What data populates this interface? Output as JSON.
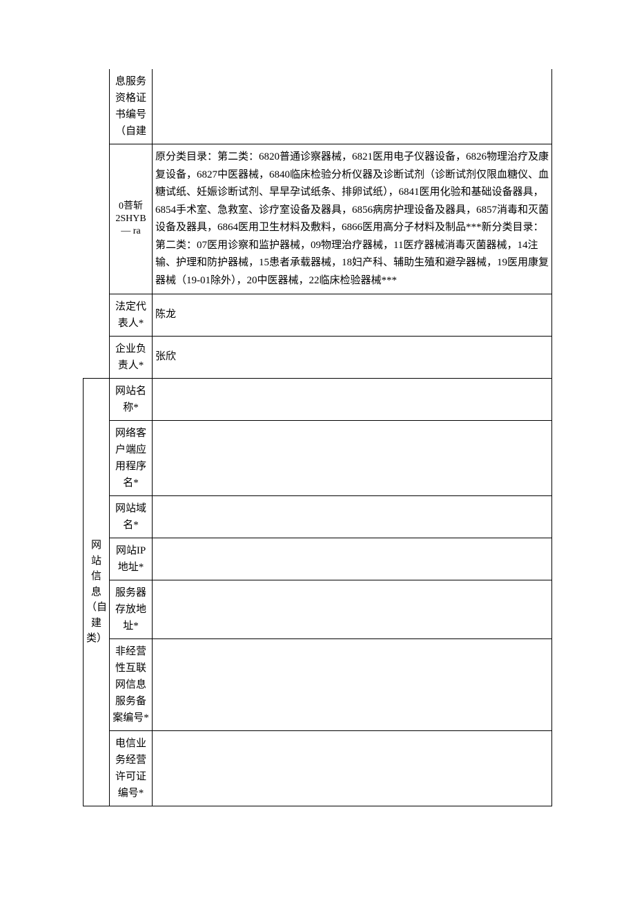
{
  "group1": {
    "label_fragment": "",
    "rows": [
      {
        "label": "息服务资格证书编号（自建",
        "value": ""
      },
      {
        "label_html": "0菩斩2SʜʏB — ra",
        "label": "0菩斩\n2SHYB\n—\nra",
        "value": "原分类目录：第二类：6820普通诊察器械，6821医用电子仪器设备，6826物理治疗及康复设备，6827中医器械，6840临床检验分析仪器及诊断试剂（诊断试剂仅限血糖仪、血糖试纸、妊娠诊断试剂、早早孕试纸条、排卵试纸），6841医用化验和基础设备器具，6854手术室、急救室、诊疗室设备及器具，6856病房护理设备及器具，6857消毒和灭菌设备及器具，6864医用卫生材料及敷料，6866医用高分子材料及制品***新分类目录：第二类：07医用诊察和监护器械，09物理治疗器械，11医疗器械消毒灭菌器械，14注输、护理和防护器械，15患者承载器械，18妇产科、辅助生殖和避孕器械，19医用康复器械（19-01除外），20中医器械，22临床检验器械***"
      },
      {
        "label": "法定代表人*",
        "value": "陈龙"
      },
      {
        "label": "企业负责人*",
        "value": "张欣"
      }
    ]
  },
  "group2": {
    "label": "网站信息（自建类）",
    "rows": [
      {
        "label": "网站名称*",
        "value": ""
      },
      {
        "label": "网络客户端应用程序名*",
        "value": ""
      },
      {
        "label": "网站域名*",
        "value": ""
      },
      {
        "label": "网站IP地址*",
        "value": ""
      },
      {
        "label": "服务器存放地址*",
        "value": ""
      },
      {
        "label": "非经营性互联网信息服务备案编号*",
        "value": ""
      },
      {
        "label": "电信业务经营许可证编号*",
        "value": ""
      }
    ]
  }
}
